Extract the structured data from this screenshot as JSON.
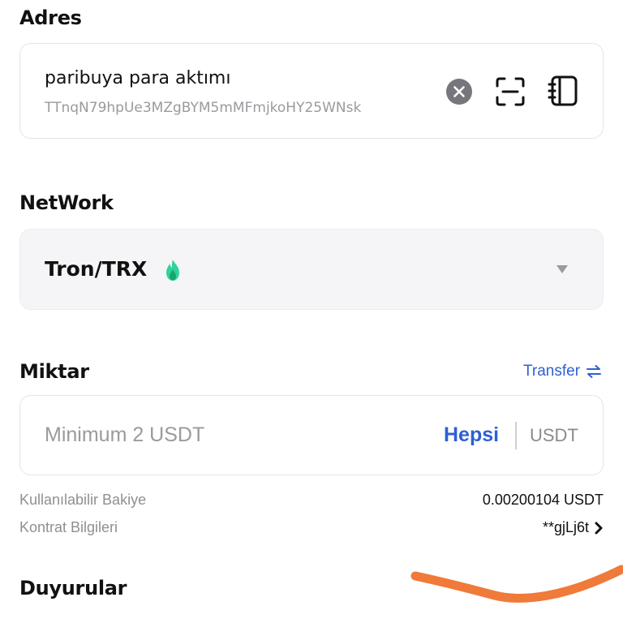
{
  "address": {
    "title": "Adres",
    "label": "paribuya para aktımı",
    "value": "TTnqN79hpUe3MZgBYM5mMFmjkoHY25WNsk",
    "icons": [
      "close-circle-icon",
      "scan-icon",
      "address-book-icon"
    ]
  },
  "network": {
    "title": "NetWork",
    "selected": "Tron/TRX",
    "icon": "flame-icon",
    "accent": "#2fd39a"
  },
  "amount": {
    "title": "Miktar",
    "transfer_label": "Transfer",
    "placeholder": "Minimum 2 USDT",
    "max_label": "Hepsi",
    "unit": "USDT"
  },
  "info": {
    "balance_label": "Kullanılabilir Bakiye",
    "balance_value": "0.00200104 USDT",
    "contract_label": "Kontrat Bilgileri",
    "contract_value": "**gjLj6t"
  },
  "announcements": {
    "title": "Duyurular"
  },
  "colors": {
    "link": "#2f5fd3",
    "muted": "#9a9a9f",
    "annotation": "#f07a3a"
  }
}
